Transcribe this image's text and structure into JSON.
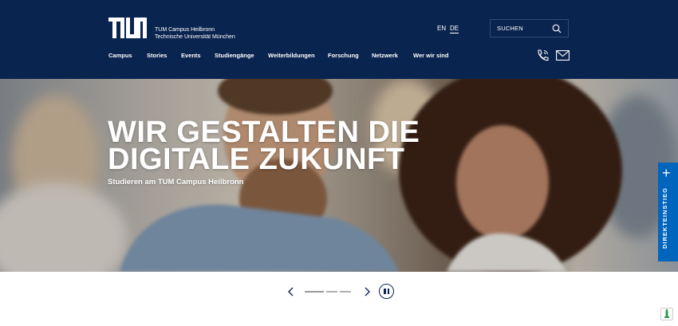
{
  "header": {
    "brand_line1": "TUM Campus Heilbronn",
    "brand_line2": "Technische Universität München",
    "lang_en": "EN",
    "lang_de": "DE",
    "search_label": "SUCHEN",
    "nav": [
      "Campus",
      "Stories",
      "Events",
      "Studiengänge",
      "Weiterbildungen",
      "Forschung",
      "Netzwerk",
      "Wer wir sind"
    ]
  },
  "hero": {
    "title_line1": "WIR GESTALTEN DIE",
    "title_line2": "DIGITALE ZUKUNFT",
    "subtitle": "Studieren am TUM Campus Heilbronn"
  },
  "direkteinstieg": {
    "label": "DIREKTEINSTIEG",
    "plus": "+"
  },
  "carousel": {
    "slides": 3,
    "active": 1
  },
  "colors": {
    "header_bg": "#0a2450",
    "accent": "#0065bd"
  },
  "icons": [
    "tum-logo",
    "search-icon",
    "phone-icon",
    "mail-icon",
    "chevron-left-icon",
    "chevron-right-icon",
    "pause-icon",
    "feedback-icon"
  ]
}
